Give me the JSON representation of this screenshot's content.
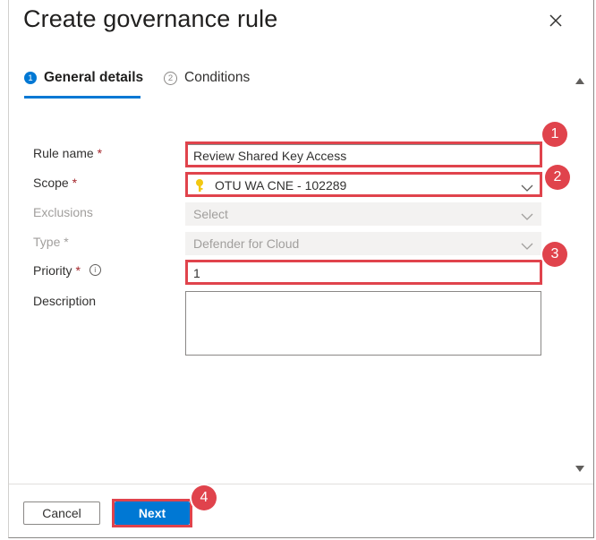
{
  "panel": {
    "title": "Create governance rule",
    "close_icon": "close-icon"
  },
  "tabs": [
    {
      "number": "1",
      "label": "General details",
      "active": true
    },
    {
      "number": "2",
      "label": "Conditions",
      "active": false
    }
  ],
  "form": {
    "rule_name": {
      "label": "Rule name",
      "required_mark": "*",
      "value": "Review Shared Key Access"
    },
    "scope": {
      "label": "Scope",
      "required_mark": "*",
      "value": "OTU WA CNE - 102289",
      "icon": "key-icon"
    },
    "exclusions": {
      "label": "Exclusions",
      "value": "Select",
      "disabled": true
    },
    "type": {
      "label": "Type",
      "required_mark": "*",
      "value": "Defender for Cloud",
      "disabled": true
    },
    "priority": {
      "label": "Priority",
      "required_mark": "*",
      "value": "1",
      "info_icon": "i"
    },
    "description": {
      "label": "Description",
      "value": ""
    }
  },
  "footer": {
    "cancel_label": "Cancel",
    "next_label": "Next"
  },
  "callouts": [
    "1",
    "2",
    "3",
    "4"
  ],
  "colors": {
    "accent": "#0078d4",
    "highlight": "#e0434c",
    "required": "#a4262c"
  }
}
